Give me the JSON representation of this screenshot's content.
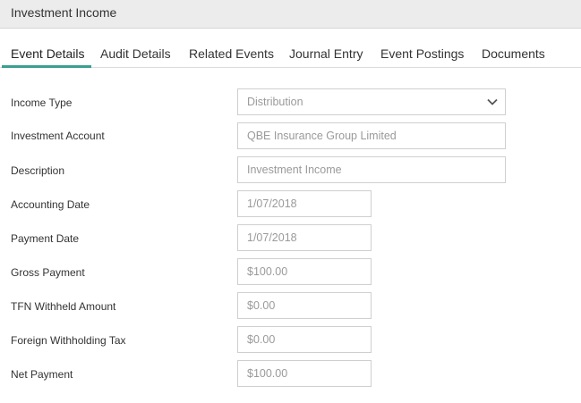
{
  "window": {
    "title": "Investment Income"
  },
  "tabs": [
    {
      "label": "Event Details",
      "active": true
    },
    {
      "label": "Audit Details"
    },
    {
      "label": "Related Events"
    },
    {
      "label": "Journal Entry"
    },
    {
      "label": "Event Postings"
    },
    {
      "label": "Documents"
    }
  ],
  "form": {
    "income_type": {
      "label": "Income Type",
      "value": "Distribution"
    },
    "investment_account": {
      "label": "Investment Account",
      "value": "QBE Insurance Group Limited"
    },
    "description": {
      "label": "Description",
      "value": "Investment Income"
    },
    "accounting_date": {
      "label": "Accounting Date",
      "value": "1/07/2018"
    },
    "payment_date": {
      "label": "Payment Date",
      "value": "1/07/2018"
    },
    "gross_payment": {
      "label": "Gross Payment",
      "value": "$100.00"
    },
    "tfn_withheld": {
      "label": "TFN Withheld Amount",
      "value": "$0.00"
    },
    "foreign_tax": {
      "label": "Foreign Withholding Tax",
      "value": "$0.00"
    },
    "net_payment": {
      "label": "Net Payment",
      "value": "$100.00"
    }
  },
  "colors": {
    "accent": "#3a9f8f",
    "titlebar_bg": "#ececec",
    "field_text": "#9a9a9a"
  },
  "icons": {
    "dropdown": "chevron-down-icon"
  }
}
